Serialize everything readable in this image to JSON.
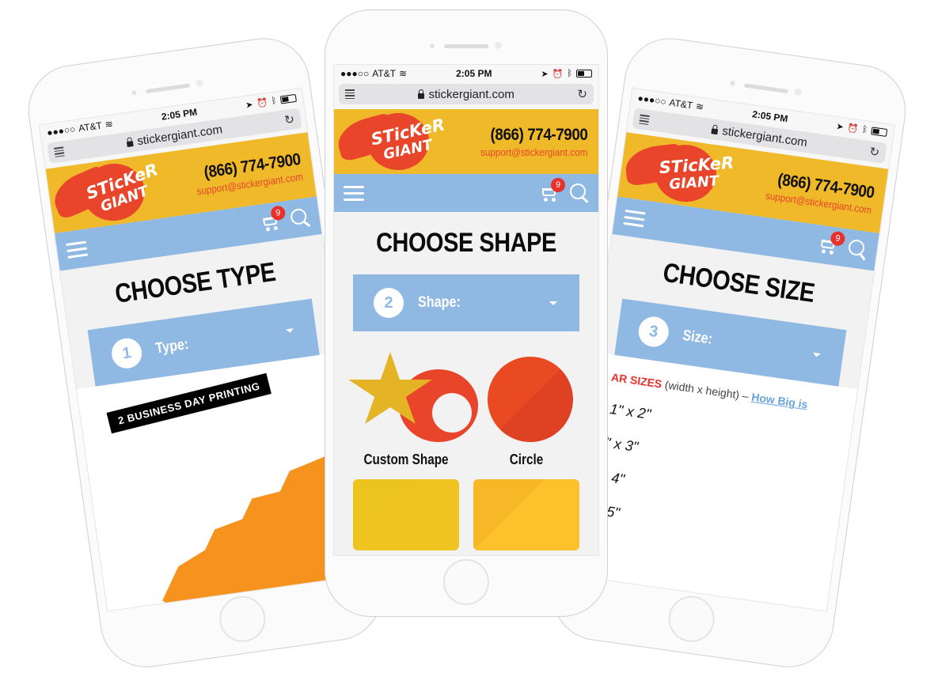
{
  "statusbar": {
    "carrier": "AT&T",
    "time": "2:05 PM"
  },
  "browser": {
    "url": "stickergiant.com"
  },
  "header": {
    "logo_top": "STicKeR",
    "logo_bottom": "GIANT",
    "phone": "(866) 774-7900",
    "email": "support@stickergiant.com"
  },
  "nav": {
    "cart_count": "9"
  },
  "left": {
    "title": "CHOOSE TYPE",
    "step_number": "1",
    "step_label": "Type:",
    "banner": "2 BUSINESS DAY PRINTING"
  },
  "center": {
    "title": "CHOOSE SHAPE",
    "step_number": "2",
    "step_label": "Shape:",
    "shapes": [
      {
        "label": "Custom Shape"
      },
      {
        "label": "Circle"
      }
    ]
  },
  "right": {
    "title": "CHOOSE SIZE",
    "step_number": "3",
    "step_label": "Size:",
    "sizes_heading_red": "AR SIZES",
    "sizes_heading_gray": "(width x height) –",
    "sizes_link": "How Big is",
    "sizes": [
      "1\" x 2\"",
      "\" x 3\"",
      "x 4\"",
      "x 5\""
    ]
  },
  "colors": {
    "brand_yellow": "#f0b92a",
    "brand_red": "#e8452a",
    "nav_blue": "#8fb9e2"
  }
}
